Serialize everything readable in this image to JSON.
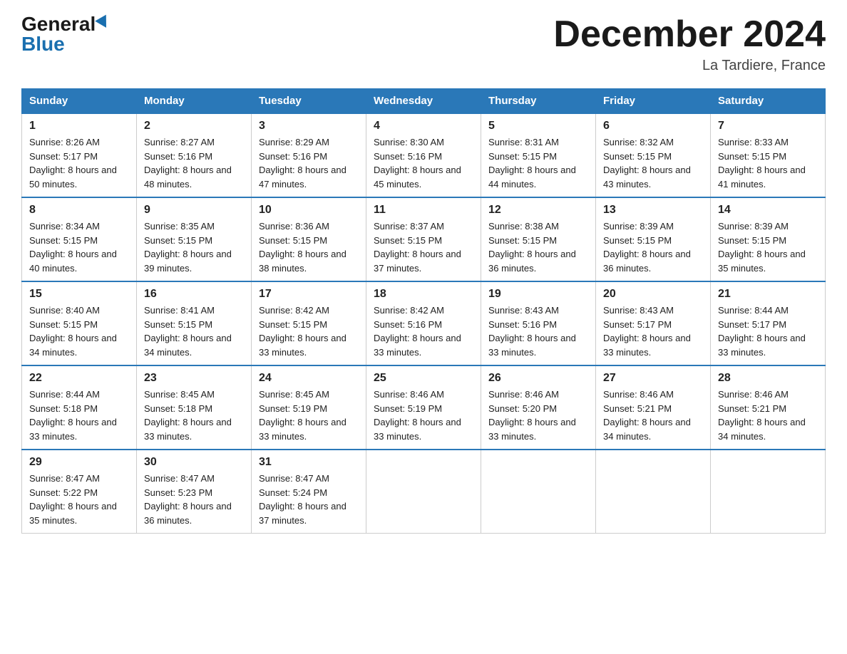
{
  "logo": {
    "general": "General",
    "blue": "Blue"
  },
  "title": "December 2024",
  "location": "La Tardiere, France",
  "days_of_week": [
    "Sunday",
    "Monday",
    "Tuesday",
    "Wednesday",
    "Thursday",
    "Friday",
    "Saturday"
  ],
  "weeks": [
    [
      {
        "day": "1",
        "sunrise": "8:26 AM",
        "sunset": "5:17 PM",
        "daylight": "8 hours and 50 minutes."
      },
      {
        "day": "2",
        "sunrise": "8:27 AM",
        "sunset": "5:16 PM",
        "daylight": "8 hours and 48 minutes."
      },
      {
        "day": "3",
        "sunrise": "8:29 AM",
        "sunset": "5:16 PM",
        "daylight": "8 hours and 47 minutes."
      },
      {
        "day": "4",
        "sunrise": "8:30 AM",
        "sunset": "5:16 PM",
        "daylight": "8 hours and 45 minutes."
      },
      {
        "day": "5",
        "sunrise": "8:31 AM",
        "sunset": "5:15 PM",
        "daylight": "8 hours and 44 minutes."
      },
      {
        "day": "6",
        "sunrise": "8:32 AM",
        "sunset": "5:15 PM",
        "daylight": "8 hours and 43 minutes."
      },
      {
        "day": "7",
        "sunrise": "8:33 AM",
        "sunset": "5:15 PM",
        "daylight": "8 hours and 41 minutes."
      }
    ],
    [
      {
        "day": "8",
        "sunrise": "8:34 AM",
        "sunset": "5:15 PM",
        "daylight": "8 hours and 40 minutes."
      },
      {
        "day": "9",
        "sunrise": "8:35 AM",
        "sunset": "5:15 PM",
        "daylight": "8 hours and 39 minutes."
      },
      {
        "day": "10",
        "sunrise": "8:36 AM",
        "sunset": "5:15 PM",
        "daylight": "8 hours and 38 minutes."
      },
      {
        "day": "11",
        "sunrise": "8:37 AM",
        "sunset": "5:15 PM",
        "daylight": "8 hours and 37 minutes."
      },
      {
        "day": "12",
        "sunrise": "8:38 AM",
        "sunset": "5:15 PM",
        "daylight": "8 hours and 36 minutes."
      },
      {
        "day": "13",
        "sunrise": "8:39 AM",
        "sunset": "5:15 PM",
        "daylight": "8 hours and 36 minutes."
      },
      {
        "day": "14",
        "sunrise": "8:39 AM",
        "sunset": "5:15 PM",
        "daylight": "8 hours and 35 minutes."
      }
    ],
    [
      {
        "day": "15",
        "sunrise": "8:40 AM",
        "sunset": "5:15 PM",
        "daylight": "8 hours and 34 minutes."
      },
      {
        "day": "16",
        "sunrise": "8:41 AM",
        "sunset": "5:15 PM",
        "daylight": "8 hours and 34 minutes."
      },
      {
        "day": "17",
        "sunrise": "8:42 AM",
        "sunset": "5:15 PM",
        "daylight": "8 hours and 33 minutes."
      },
      {
        "day": "18",
        "sunrise": "8:42 AM",
        "sunset": "5:16 PM",
        "daylight": "8 hours and 33 minutes."
      },
      {
        "day": "19",
        "sunrise": "8:43 AM",
        "sunset": "5:16 PM",
        "daylight": "8 hours and 33 minutes."
      },
      {
        "day": "20",
        "sunrise": "8:43 AM",
        "sunset": "5:17 PM",
        "daylight": "8 hours and 33 minutes."
      },
      {
        "day": "21",
        "sunrise": "8:44 AM",
        "sunset": "5:17 PM",
        "daylight": "8 hours and 33 minutes."
      }
    ],
    [
      {
        "day": "22",
        "sunrise": "8:44 AM",
        "sunset": "5:18 PM",
        "daylight": "8 hours and 33 minutes."
      },
      {
        "day": "23",
        "sunrise": "8:45 AM",
        "sunset": "5:18 PM",
        "daylight": "8 hours and 33 minutes."
      },
      {
        "day": "24",
        "sunrise": "8:45 AM",
        "sunset": "5:19 PM",
        "daylight": "8 hours and 33 minutes."
      },
      {
        "day": "25",
        "sunrise": "8:46 AM",
        "sunset": "5:19 PM",
        "daylight": "8 hours and 33 minutes."
      },
      {
        "day": "26",
        "sunrise": "8:46 AM",
        "sunset": "5:20 PM",
        "daylight": "8 hours and 33 minutes."
      },
      {
        "day": "27",
        "sunrise": "8:46 AM",
        "sunset": "5:21 PM",
        "daylight": "8 hours and 34 minutes."
      },
      {
        "day": "28",
        "sunrise": "8:46 AM",
        "sunset": "5:21 PM",
        "daylight": "8 hours and 34 minutes."
      }
    ],
    [
      {
        "day": "29",
        "sunrise": "8:47 AM",
        "sunset": "5:22 PM",
        "daylight": "8 hours and 35 minutes."
      },
      {
        "day": "30",
        "sunrise": "8:47 AM",
        "sunset": "5:23 PM",
        "daylight": "8 hours and 36 minutes."
      },
      {
        "day": "31",
        "sunrise": "8:47 AM",
        "sunset": "5:24 PM",
        "daylight": "8 hours and 37 minutes."
      },
      null,
      null,
      null,
      null
    ]
  ]
}
